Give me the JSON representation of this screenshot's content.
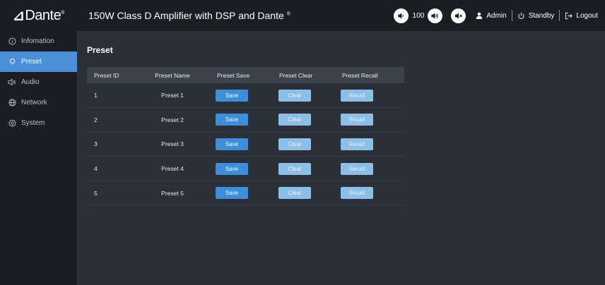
{
  "brand": {
    "logo_mark": "⊿",
    "logo_text": "Dante",
    "logo_reg": "®"
  },
  "header": {
    "title": "150W Class D Amplifier with DSP and Dante",
    "title_reg": "®",
    "volume_value": "100",
    "user_label": "Admin",
    "standby_label": "Standby",
    "logout_label": "Logout"
  },
  "sidebar": {
    "items": [
      {
        "label": "Infomation",
        "icon": "info-icon"
      },
      {
        "label": "Preset",
        "icon": "preset-icon",
        "active": true
      },
      {
        "label": "Audio",
        "icon": "speaker-icon"
      },
      {
        "label": "Network",
        "icon": "globe-icon"
      },
      {
        "label": "System",
        "icon": "gear-icon"
      }
    ]
  },
  "main": {
    "page_title": "Preset",
    "table": {
      "headers": [
        "Preset ID",
        "Preset Name",
        "Preset Save",
        "Preset Clear",
        "Preset Recall"
      ],
      "rows": [
        {
          "id": "1",
          "name": "Preset 1",
          "save": "Save",
          "clear": "Clear",
          "recall": "Recall"
        },
        {
          "id": "2",
          "name": "Preset 2",
          "save": "Save",
          "clear": "Clear",
          "recall": "Recall"
        },
        {
          "id": "3",
          "name": "Preset 3",
          "save": "Save",
          "clear": "Clear",
          "recall": "Recall"
        },
        {
          "id": "4",
          "name": "Preset 4",
          "save": "Save",
          "clear": "Clear",
          "recall": "Recall"
        },
        {
          "id": "5",
          "name": "Preset 5",
          "save": "Save",
          "clear": "Clear",
          "recall": "Recall"
        }
      ]
    }
  },
  "colors": {
    "sidebar_bg": "#1b1d22",
    "content_bg": "#2a2f38",
    "active_nav": "#4a90d9",
    "save_button": "#3d8fdc",
    "disabled_button": "#8bbfe8"
  }
}
